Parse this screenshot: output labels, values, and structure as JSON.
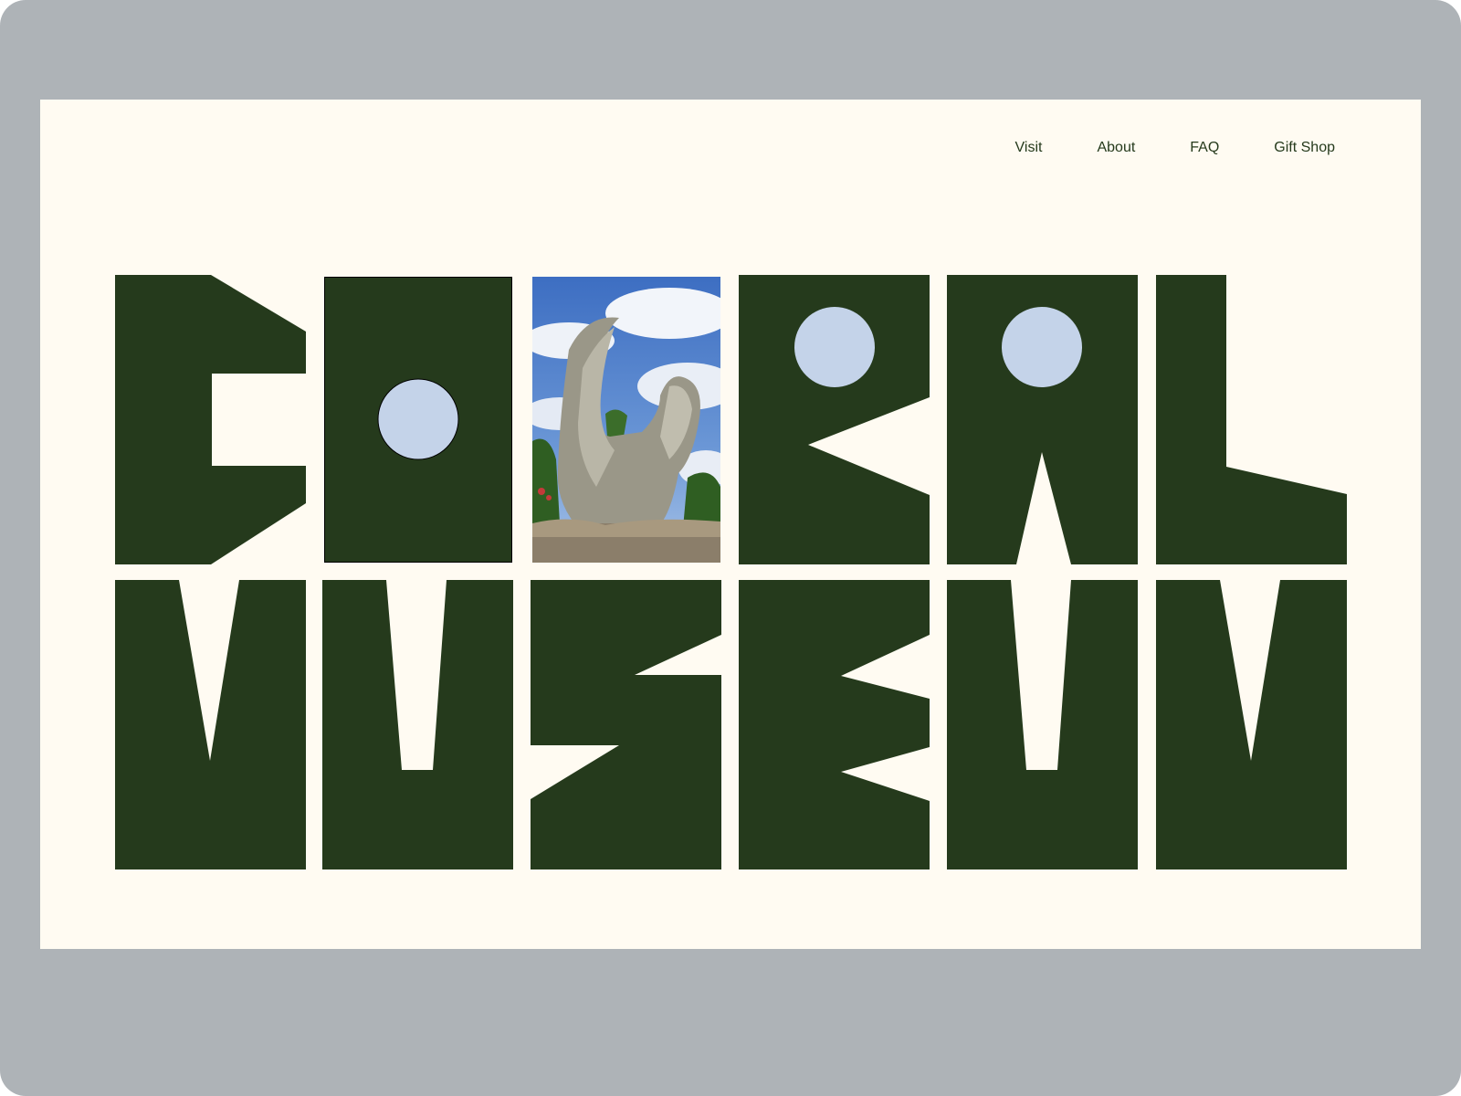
{
  "nav": {
    "items": [
      {
        "label": "Visit"
      },
      {
        "label": "About"
      },
      {
        "label": "FAQ"
      },
      {
        "label": "Gift Shop"
      }
    ]
  },
  "logo": {
    "wordmark": "CORAL MUSEUM",
    "line1": [
      "C",
      "O",
      "R",
      "A",
      "L"
    ],
    "line2": [
      "M",
      "U",
      "S",
      "E",
      "U",
      "M"
    ]
  },
  "photo": {
    "subject": "coral-rock-crescent-moon-sculpture"
  },
  "colors": {
    "frame": "#aeb3b7",
    "page": "#fffbf2",
    "brand_green": "#253a1c",
    "circle_blue": "#c4d3e9"
  }
}
